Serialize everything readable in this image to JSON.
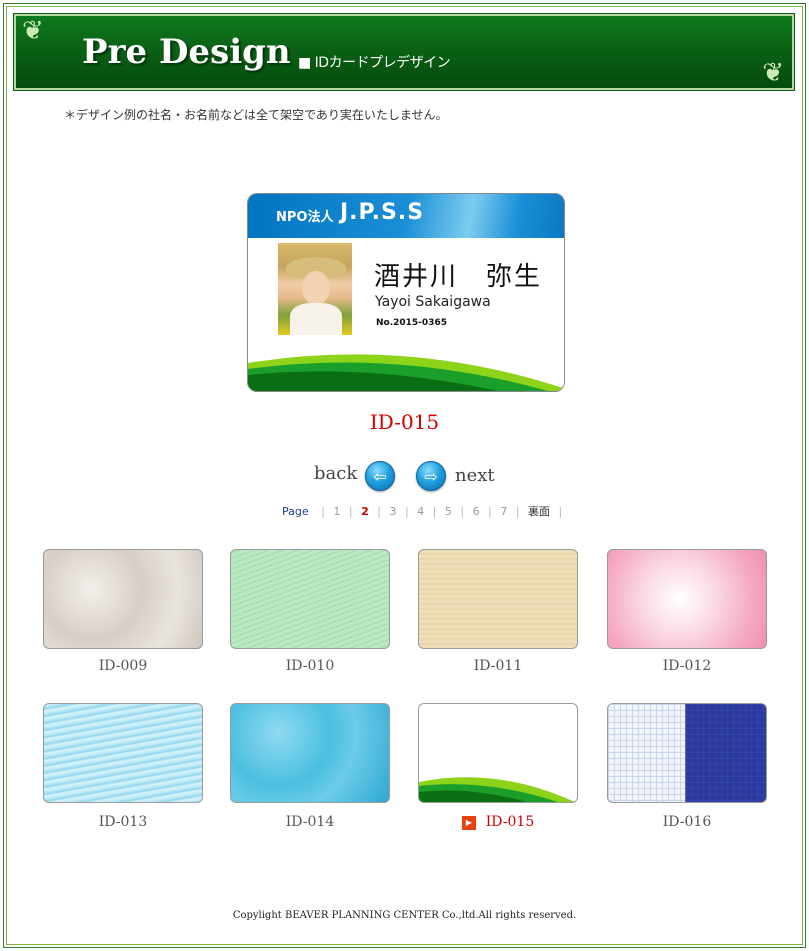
{
  "header": {
    "title": "Pre Design",
    "subtitle": "■ IDカードプレデザイン"
  },
  "note": "＊デザイン例の社名・お名前などは全て架空であり実在いたしません。",
  "card": {
    "org_prefix": "NPO法人",
    "org_name": "J.P.S.S",
    "name_jp": "酒井川　弥生",
    "name_romaji": "Yayoi Sakaigawa",
    "number": "No.2015-0365"
  },
  "current_id": "ID-015",
  "nav": {
    "back_label": "back",
    "next_label": "next"
  },
  "pagination": {
    "label": "Page",
    "pages": [
      "1",
      "2",
      "3",
      "4",
      "5",
      "6",
      "7"
    ],
    "current_page": "2",
    "back_side_label": "裏面"
  },
  "thumbnails": [
    {
      "id": "ID-009"
    },
    {
      "id": "ID-010"
    },
    {
      "id": "ID-011"
    },
    {
      "id": "ID-012"
    },
    {
      "id": "ID-013"
    },
    {
      "id": "ID-014"
    },
    {
      "id": "ID-015",
      "selected": true
    },
    {
      "id": "ID-016"
    }
  ],
  "footer": "Copylight BEAVER PLANNING CENTER  Co.,ltd.All rights reserved.",
  "colors": {
    "header_green": "#0a6216",
    "active_red": "#d40000",
    "card_blue": "#0074c1",
    "wave_green": "#0a8a1a",
    "wave_lime": "#8cd31a"
  }
}
